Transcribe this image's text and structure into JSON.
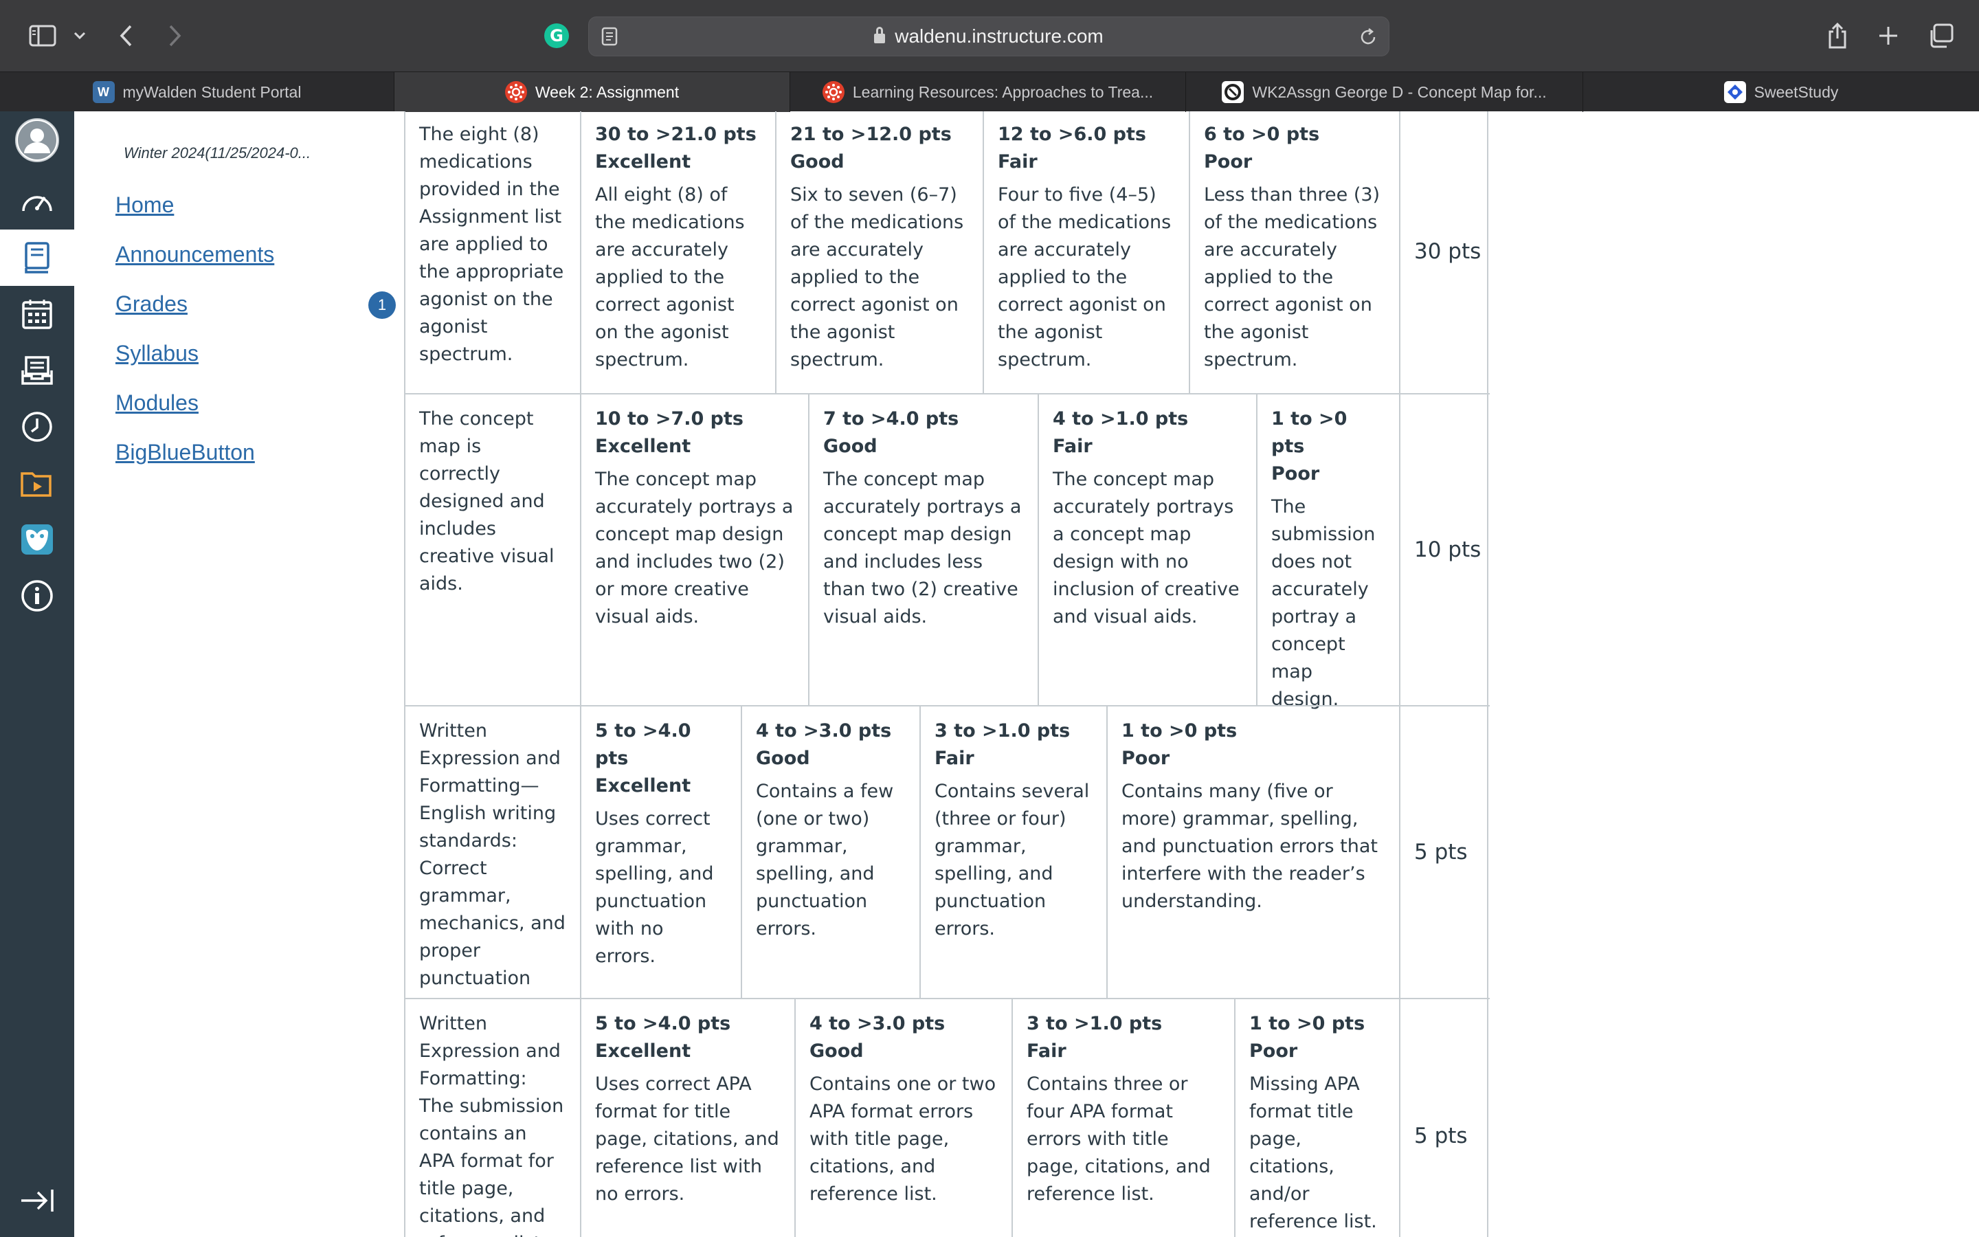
{
  "browser": {
    "url": "waldenu.instructure.com",
    "tabs": [
      {
        "label": "myWalden Student Portal",
        "icon": "walden-w-icon",
        "active": false
      },
      {
        "label": "Week 2: Assignment",
        "icon": "canvas-icon",
        "active": true
      },
      {
        "label": "Learning Resources: Approaches to Trea...",
        "icon": "canvas-icon",
        "active": false
      },
      {
        "label": "WK2Assgn George D - Concept Map for...",
        "icon": "doc-icon",
        "active": false
      },
      {
        "label": "SweetStudy",
        "icon": "sweetstudy-icon",
        "active": false
      }
    ]
  },
  "course_nav": {
    "term": "Winter 2024(11/25/2024-0...",
    "links": [
      "Home",
      "Announcements",
      "Grades",
      "Syllabus",
      "Modules",
      "BigBlueButton"
    ],
    "grades_badge": "1"
  },
  "rubric": {
    "rows": [
      {
        "criterion": "The eight (8) medications provided in the Assignment list are applied to the appropriate agonist on the agonist spectrum.",
        "ratings": [
          {
            "range": "30 to >21.0 pts",
            "label": "Excellent",
            "desc": "All eight (8) of the medications are accurately applied to the correct agonist on the agonist spectrum."
          },
          {
            "range": "21 to >12.0 pts",
            "label": "Good",
            "desc": "Six to seven (6–7) of the medications are accurately applied to the correct agonist on the agonist spectrum."
          },
          {
            "range": "12 to >6.0 pts",
            "label": "Fair",
            "desc": "Four to five (4–5) of the medications are accurately applied to the correct agonist on the agonist spectrum."
          },
          {
            "range": "6 to >0 pts",
            "label": "Poor",
            "desc": "Less than three (3) of the medications are accurately applied to the correct agonist on the agonist spectrum."
          }
        ],
        "points": "30 pts"
      },
      {
        "criterion": "The concept map is correctly designed and includes creative visual aids.",
        "ratings": [
          {
            "range": "10 to >7.0 pts",
            "label": "Excellent",
            "desc": "The concept map accurately portrays a concept map design and includes two (2) or more creative visual aids."
          },
          {
            "range": "7 to >4.0 pts",
            "label": "Good",
            "desc": "The concept map accurately portrays a concept map design and includes less than two (2) creative visual aids."
          },
          {
            "range": "4 to >1.0 pts",
            "label": "Fair",
            "desc": "The concept map accurately portrays a concept map design with no inclusion of creative and visual aids."
          },
          {
            "range": "1 to >0 pts",
            "label": "Poor",
            "desc": "The submission does not accurately portray a concept map design."
          }
        ],
        "points": "10 pts"
      },
      {
        "criterion": "Written Expression and Formatting—English writing standards: Correct grammar, mechanics, and proper punctuation",
        "ratings": [
          {
            "range": "5 to >4.0 pts",
            "label": "Excellent",
            "desc": "Uses correct grammar, spelling, and punctuation with no errors."
          },
          {
            "range": "4 to >3.0 pts",
            "label": "Good",
            "desc": "Contains a few (one or two) grammar, spelling, and punctuation errors."
          },
          {
            "range": "3 to >1.0 pts",
            "label": "Fair",
            "desc": "Contains several (three or four) grammar, spelling, and punctuation errors."
          },
          {
            "range": "1 to >0 pts",
            "label": "Poor",
            "desc": "Contains many (five or more) grammar, spelling, and punctuation errors that interfere with the reader’s understanding."
          }
        ],
        "points": "5 pts"
      },
      {
        "criterion": "Written Expression and Formatting: The submission contains an APA format for title page, citations, and reference list.",
        "ratings": [
          {
            "range": "5 to >4.0 pts",
            "label": "Excellent",
            "desc": "Uses correct APA format for title page, citations, and reference list with no errors."
          },
          {
            "range": "4 to >3.0 pts",
            "label": "Good",
            "desc": "Contains one or two APA format errors with title page, citations, and reference list."
          },
          {
            "range": "3 to >1.0 pts",
            "label": "Fair",
            "desc": "Contains three or four APA format errors with title page, citations, and reference list."
          },
          {
            "range": "1 to >0 pts",
            "label": "Poor",
            "desc": "Missing APA format title page, citations, and/or reference list."
          }
        ],
        "points": "5 pts"
      }
    ]
  },
  "colors": {
    "global_nav": "#2d3b45",
    "link": "#2b6aa8",
    "grid": "#c7cdd1",
    "text": "#2d3b45"
  }
}
